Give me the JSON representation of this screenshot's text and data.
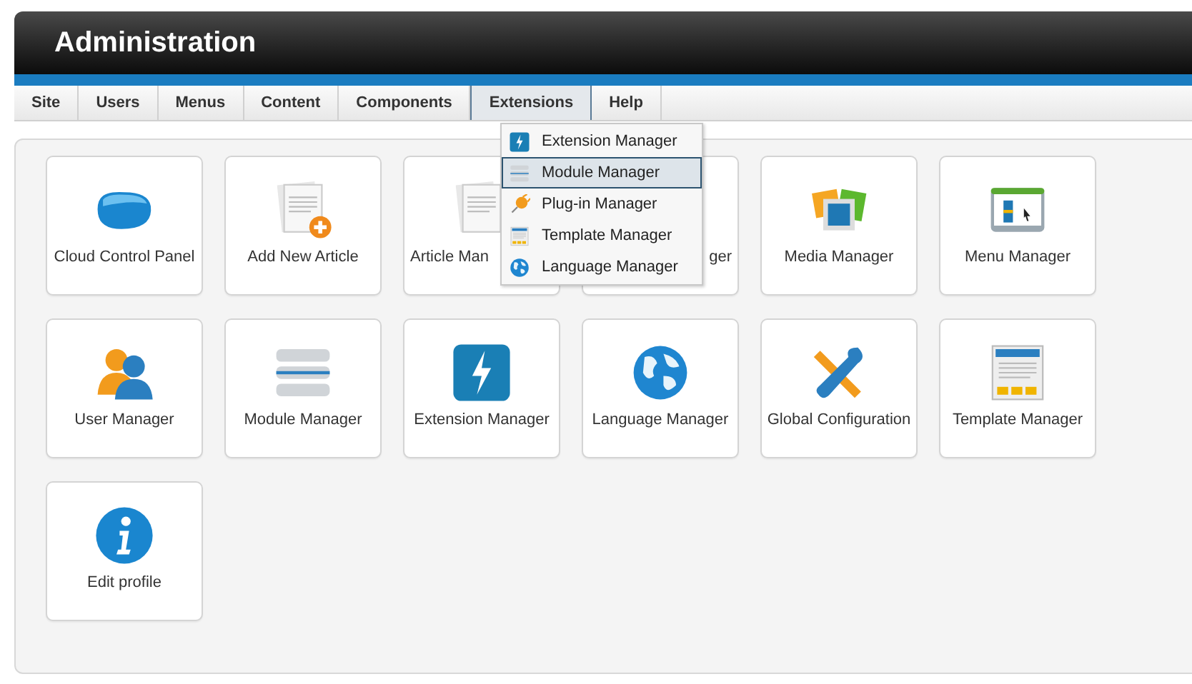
{
  "header": {
    "title": "Administration"
  },
  "menu_bar": [
    {
      "label": "Site",
      "selected": false
    },
    {
      "label": "Users",
      "selected": false
    },
    {
      "label": "Menus",
      "selected": false
    },
    {
      "label": "Content",
      "selected": false
    },
    {
      "label": "Components",
      "selected": false
    },
    {
      "label": "Extensions",
      "selected": true
    },
    {
      "label": "Help",
      "selected": false
    }
  ],
  "dropdown": [
    {
      "label": "Extension Manager",
      "kind": "bolt",
      "selected": false
    },
    {
      "label": "Module Manager",
      "kind": "module",
      "selected": true
    },
    {
      "label": "Plug-in Manager",
      "kind": "plug",
      "selected": false
    },
    {
      "label": "Template Manager",
      "kind": "template",
      "selected": false
    },
    {
      "label": "Language Manager",
      "kind": "globe",
      "selected": false
    }
  ],
  "tiles": [
    {
      "label": "Cloud Control Panel",
      "kind": "cloud"
    },
    {
      "label": "Add New Article",
      "kind": "articleadd"
    },
    {
      "label": "Article Man",
      "kind": "article"
    },
    {
      "label": "ger",
      "kind": "covered"
    },
    {
      "label": "Media Manager",
      "kind": "media"
    },
    {
      "label": "Menu Manager",
      "kind": "menu"
    },
    {
      "label": "User Manager",
      "kind": "user"
    },
    {
      "label": "Module Manager",
      "kind": "module"
    },
    {
      "label": "Extension Manager",
      "kind": "bolt"
    },
    {
      "label": "Language Manager",
      "kind": "globe"
    },
    {
      "label": "Global Configuration",
      "kind": "tools"
    },
    {
      "label": "Template Manager",
      "kind": "template"
    },
    {
      "label": "Edit profile",
      "kind": "info"
    }
  ]
}
